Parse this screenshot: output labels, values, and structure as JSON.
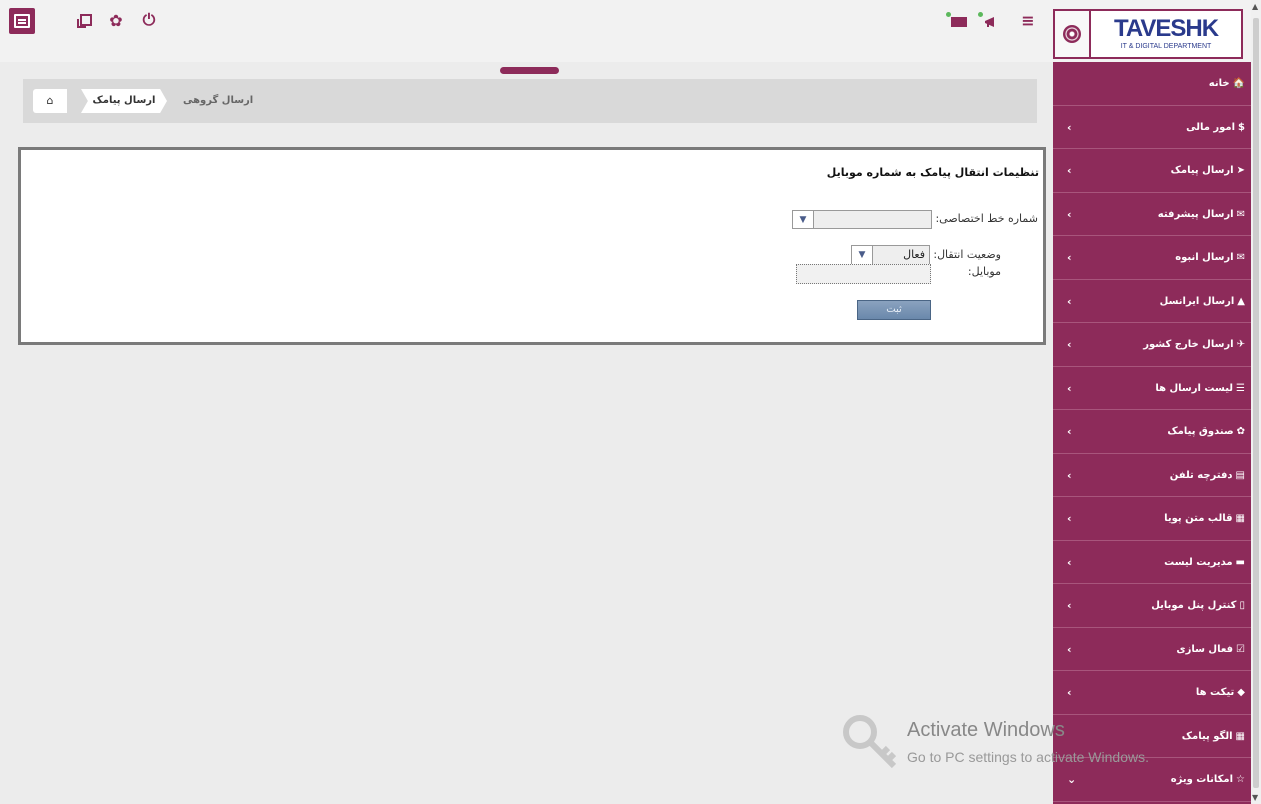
{
  "header": {
    "logo_title": "TAVESHK",
    "logo_subtitle": "IT & DIGITAL DEPARTMENT",
    "icons": [
      "sidebar-toggle-icon",
      "window-icon",
      "gear-icon",
      "power-icon",
      "mail-icon",
      "megaphone-icon",
      "menu-icon"
    ]
  },
  "breadcrumb": {
    "home": "⌂",
    "items": [
      "ارسال پیامک",
      "ارسال گروهی"
    ]
  },
  "form": {
    "title": "تنظیمات انتقال پیامک به شماره موبایل",
    "line_label": "شماره خط اختصاصی:",
    "line_value": "",
    "status_label": "وضعیت انتقال:",
    "status_value": "فعال",
    "mobile_label": "موبایل:",
    "mobile_value": "",
    "submit_label": "ثبت"
  },
  "sidebar": {
    "items": [
      {
        "icon": "🏠",
        "label": "خانه",
        "chevron": ""
      },
      {
        "icon": "$",
        "label": "امور مالی",
        "chevron": "‹"
      },
      {
        "icon": "➤",
        "label": "ارسال پیامک",
        "chevron": "‹"
      },
      {
        "icon": "✉",
        "label": "ارسال پیشرفته",
        "chevron": "‹"
      },
      {
        "icon": "✉",
        "label": "ارسال انبوه",
        "chevron": "‹"
      },
      {
        "icon": "▲",
        "label": "ارسال ایرانسل",
        "chevron": "‹"
      },
      {
        "icon": "✈",
        "label": "ارسال خارج کشور",
        "chevron": "‹"
      },
      {
        "icon": "☰",
        "label": "لیست ارسال ها",
        "chevron": "‹"
      },
      {
        "icon": "✿",
        "label": "صندوق پیامک",
        "chevron": "‹"
      },
      {
        "icon": "▤",
        "label": "دفترچه تلفن",
        "chevron": "‹"
      },
      {
        "icon": "▦",
        "label": "قالب متن پویا",
        "chevron": "‹"
      },
      {
        "icon": "▬",
        "label": "مدیریت لیست",
        "chevron": "‹"
      },
      {
        "icon": "▯",
        "label": "کنترل پنل موبایل",
        "chevron": "‹"
      },
      {
        "icon": "☑",
        "label": "فعال سازی",
        "chevron": "‹"
      },
      {
        "icon": "◆",
        "label": "تیکت ها",
        "chevron": "‹"
      },
      {
        "icon": "▦",
        "label": "الگو پیامک",
        "chevron": ""
      },
      {
        "icon": "☆",
        "label": "امکانات ویژه",
        "chevron": "⌄"
      }
    ]
  },
  "watermark": {
    "title": "Activate Windows",
    "subtitle": "Go to PC settings to activate Windows."
  },
  "colors": {
    "brand": "#8d2b5a",
    "logo_blue": "#2a3a8c",
    "notify_green": "#5cb85c"
  }
}
